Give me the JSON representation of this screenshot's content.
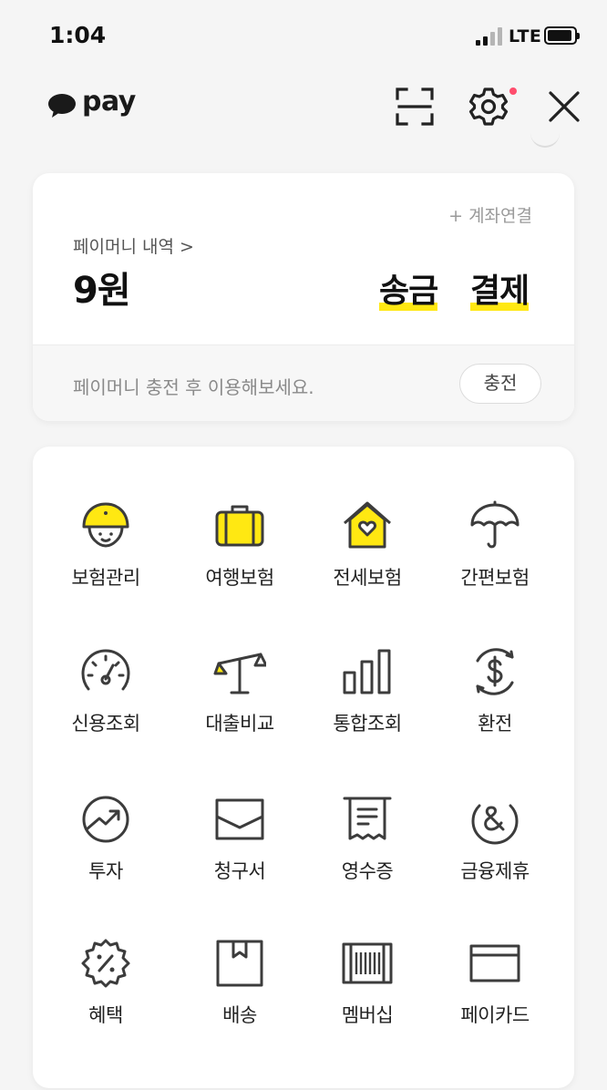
{
  "status_bar": {
    "time": "1:04",
    "network": "LTE"
  },
  "header": {
    "brand": "pay",
    "icons": [
      "scan-icon",
      "settings-icon",
      "close-icon"
    ],
    "settings_has_notification": true
  },
  "pay_money": {
    "account_link": "+ 계좌연결",
    "history_label": "페이머니 내역 >",
    "balance": "9원",
    "actions": [
      "송금",
      "결제"
    ],
    "hint": "페이머니 충전 후 이용해보세요.",
    "charge_button": "충전"
  },
  "menu": {
    "items": [
      {
        "label": "보험관리",
        "icon": "helmet-face-icon"
      },
      {
        "label": "여행보험",
        "icon": "suitcase-icon"
      },
      {
        "label": "전세보험",
        "icon": "house-heart-icon"
      },
      {
        "label": "간편보험",
        "icon": "umbrella-icon"
      },
      {
        "label": "신용조회",
        "icon": "gauge-icon"
      },
      {
        "label": "대출비교",
        "icon": "scale-icon"
      },
      {
        "label": "통합조회",
        "icon": "bar-chart-icon"
      },
      {
        "label": "환전",
        "icon": "dollar-exchange-icon"
      },
      {
        "label": "투자",
        "icon": "trend-up-icon"
      },
      {
        "label": "청구서",
        "icon": "envelope-icon"
      },
      {
        "label": "영수증",
        "icon": "receipt-icon"
      },
      {
        "label": "금융제휴",
        "icon": "ampersand-icon"
      },
      {
        "label": "혜택",
        "icon": "percent-badge-icon"
      },
      {
        "label": "배송",
        "icon": "package-icon"
      },
      {
        "label": "멤버십",
        "icon": "barcode-icon"
      },
      {
        "label": "페이카드",
        "icon": "card-icon"
      }
    ]
  },
  "colors": {
    "accent": "#ffe812",
    "notification": "#ff4d6d",
    "icon_stroke": "#3c3c3c"
  }
}
